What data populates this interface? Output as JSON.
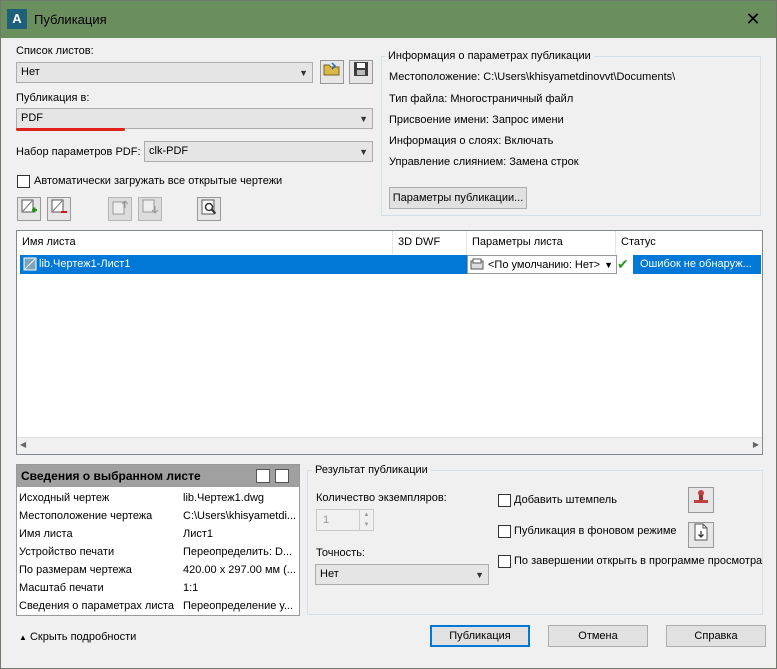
{
  "window": {
    "title": "Публикация",
    "app_icon": "A"
  },
  "sheet_list": {
    "label": "Список листов:",
    "value": "Нет"
  },
  "publish_to": {
    "label": "Публикация в:",
    "value": "PDF"
  },
  "pdf_preset": {
    "label": "Набор параметров PDF:",
    "value": "clk-PDF"
  },
  "auto_load": {
    "label": "Автоматически загружать все открытые чертежи",
    "checked": false
  },
  "info": {
    "title": "Информация о параметрах публикации",
    "location": "Местоположение:   C:\\Users\\khisyametdinovvt\\Documents\\",
    "file_type": "Тип файла: Многостраничный файл",
    "naming": "Присвоение имени: Запрос имени",
    "layers": "Информация о слоях:  Включать",
    "merge": "Управление слиянием: Замена строк",
    "params_button": "Параметры публикации..."
  },
  "table": {
    "columns": [
      "Имя листа",
      "3D DWF",
      "Параметры листа",
      "Статус"
    ],
    "rows": [
      {
        "name": "lib.Чертеж1-Лист1",
        "dwf": "",
        "params": "<По умолчанию: Нет>",
        "status": "Ошибок не обнаруж..."
      }
    ]
  },
  "details": {
    "title": "Сведения о выбранном листе",
    "rows": [
      {
        "key": "Исходный чертеж",
        "value": "lib.Чертеж1.dwg"
      },
      {
        "key": "Местоположение чертежа",
        "value": "C:\\Users\\khisyametdi..."
      },
      {
        "key": "Имя листа",
        "value": "Лист1"
      },
      {
        "key": "Устройство печати",
        "value": "Переопределить: D..."
      },
      {
        "key": "По размерам чертежа",
        "value": "420.00 x 297.00 мм (..."
      },
      {
        "key": "Масштаб печати",
        "value": "1:1"
      },
      {
        "key": "Сведения о параметрах листа",
        "value": "Переопределение у..."
      }
    ]
  },
  "result": {
    "title": "Результат публикации",
    "copies_label": "Количество экземпляров:",
    "copies_value": "1",
    "precision_label": "Точность:",
    "precision_value": "Нет",
    "stamp_label": "Добавить штемпель",
    "background_label": "Публикация в фоновом режиме",
    "open_viewer_label": "По завершении открыть в программе просмотра"
  },
  "footer": {
    "hide_details": "Скрыть подробности",
    "publish": "Публикация",
    "cancel": "Отмена",
    "help": "Справка"
  },
  "colors": {
    "titlebar": "#6b8e5f",
    "selection": "#0078d7",
    "underline": "#e0201b"
  }
}
